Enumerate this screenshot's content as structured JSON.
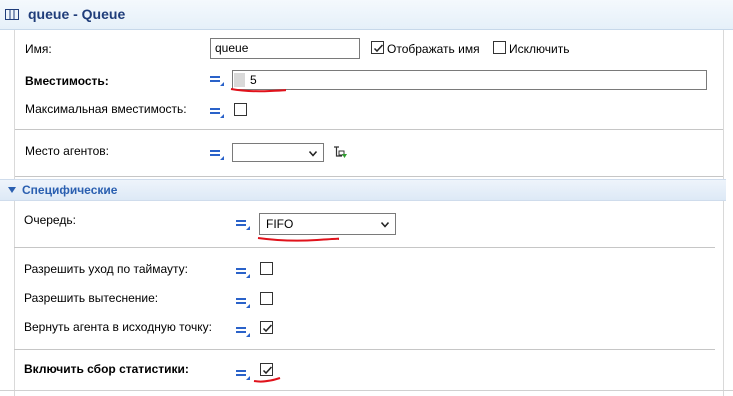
{
  "title": "queue - Queue",
  "name_row": {
    "label": "Имя:",
    "value": "queue",
    "show_name": {
      "label": "Отображать имя",
      "checked": true
    },
    "exclude": {
      "label": "Исключить",
      "checked": false
    }
  },
  "capacity": {
    "label": "Вместимость:",
    "value": "5"
  },
  "max_capacity": {
    "label": "Максимальная вместимость:",
    "checked": false
  },
  "agent_location": {
    "label": "Место агентов:",
    "value": ""
  },
  "section": {
    "label": "Специфические"
  },
  "queue": {
    "label": "Очередь:",
    "value": "FIFO"
  },
  "timeout": {
    "label": "Разрешить уход по таймауту:",
    "checked": false
  },
  "preemption": {
    "label": "Разрешить вытеснение:",
    "checked": false
  },
  "return_agent": {
    "label": "Вернуть агента в исходную точку:",
    "checked": true
  },
  "statistics": {
    "label": "Включить сбор статистики:",
    "checked": true
  },
  "colors": {
    "accent": "#2a62c9",
    "section_text": "#2a5fb0",
    "annotation": "#e0121b"
  },
  "icons": [
    "table-icon",
    "equals-icon",
    "checkbox-icon",
    "chevron-down-icon",
    "location-picker-icon",
    "collapse-triangle-icon"
  ]
}
